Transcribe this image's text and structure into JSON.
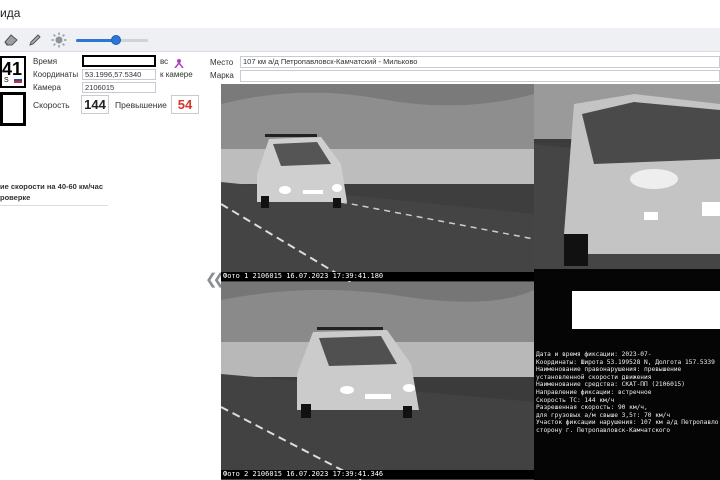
{
  "window": {
    "title": "ида"
  },
  "toolbar": {
    "brightness_level": 0.55
  },
  "left": {
    "plate_symbols": "41",
    "plate_small": "S",
    "time_label": "Время",
    "time_suffix": "вс",
    "coords_label": "Координаты",
    "coords_value": "53.1996,57.5340",
    "to_camera": "к камере",
    "camera_label": "Камера",
    "camera_value": "2106015",
    "speed_label": "Скорость",
    "speed_value": "144",
    "excess_label": "Превышение",
    "excess_value": "54",
    "violation_line1": "ие скорости на 40-60 км/час",
    "violation_line2": "роверке"
  },
  "place": {
    "label": "Место",
    "value": "107 км а/д Петропавловск-Камчатский - Мильково",
    "brand_label": "Марка",
    "brand_value": ""
  },
  "photos": {
    "caption1": "Фото 1 2106015 16.07.2023 17:39:41.180",
    "caption2": "Фото 2 2106015 16.07.2023 17:39:41.346"
  },
  "info": {
    "lines": [
      "Дата и время фиксации: 2023-07-",
      "Координаты:  Широта 53.199528 N,  Долгота 157.5339",
      "Наименование правонарушения: превышение",
      "установленной скорости движения",
      "Наименование средства: СКАТ-ПП (2106015)",
      "Направление фиксации: встречное",
      "Скорость ТС: 144 км/ч",
      "Разрешенная скорость: 90 км/ч,",
      "для грузовых а/м свыше 3,5т: 70 км/ч",
      "Участок фиксации нарушения: 107 км а/д Петропавло",
      "сторону г. Петропавловск-Камчатского"
    ]
  },
  "colors": {
    "accent": "#2b78d4",
    "excess": "#d9342b",
    "toolbar_bg": "#eef0f3"
  }
}
